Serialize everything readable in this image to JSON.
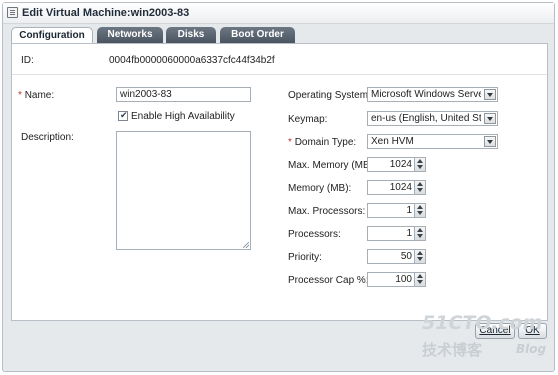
{
  "window": {
    "title": "Edit Virtual Machine:win2003-83"
  },
  "tabs": [
    {
      "label": "Configuration",
      "active": true
    },
    {
      "label": "Networks",
      "active": false
    },
    {
      "label": "Disks",
      "active": false
    },
    {
      "label": "Boot Order",
      "active": false
    }
  ],
  "config": {
    "id_label": "ID:",
    "id_value": "0004fb0000060000a6337cfc44f34b2f",
    "required_mark": "*",
    "name_label": "Name:",
    "name_value": "win2003-83",
    "ha_label": "Enable High Availability",
    "ha_checked": true,
    "ha_check_glyph": "✔",
    "description_label": "Description:",
    "description_value": "",
    "os_label": "Operating System:",
    "os_value": "Microsoft Windows Server",
    "keymap_label": "Keymap:",
    "keymap_value": "en-us (English, United Sta",
    "domain_label": "Domain Type:",
    "domain_value": "Xen HVM",
    "max_memory_label": "Max. Memory (MB):",
    "max_memory_value": "1024",
    "memory_label": "Memory (MB):",
    "memory_value": "1024",
    "max_processors_label": "Max. Processors:",
    "max_processors_value": "1",
    "processors_label": "Processors:",
    "processors_value": "1",
    "priority_label": "Priority:",
    "priority_value": "50",
    "cap_label": "Processor Cap %:",
    "cap_value": "100"
  },
  "buttons": {
    "cancel": "Cancel",
    "ok": "OK"
  },
  "watermark": {
    "line1": "51CTO.com",
    "line2": "技术博客",
    "line3": "Blog"
  }
}
